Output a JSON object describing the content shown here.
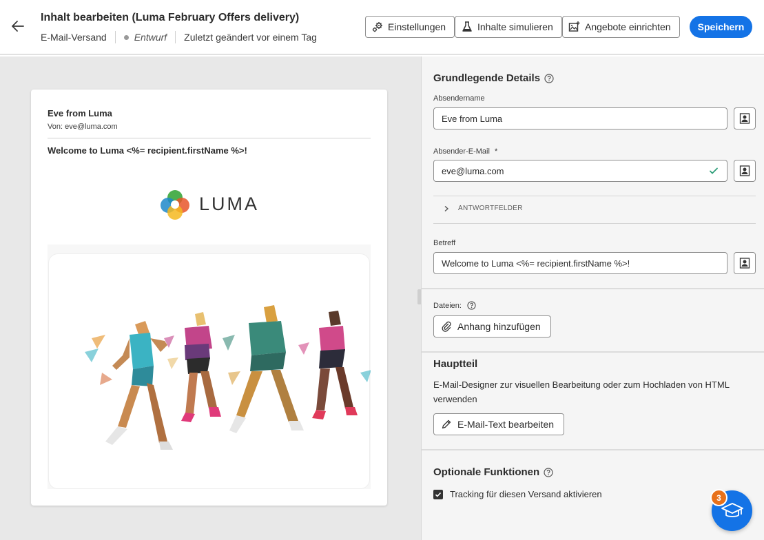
{
  "header": {
    "title": "Inhalt bearbeiten (Luma February Offers delivery)",
    "channel": "E-Mail-Versand",
    "status": "Entwurf",
    "modified": "Zuletzt geändert vor einem Tag",
    "buttons": {
      "settings": "Einstellungen",
      "simulate": "Inhalte simulieren",
      "offers": "Angebote einrichten",
      "save": "Speichern"
    }
  },
  "preview": {
    "sender_name": "Eve from Luma",
    "sender_from": "Von: eve@luma.com",
    "subject": "Welcome to Luma <%= recipient.firstName %>!",
    "logo_text": "LUMA"
  },
  "details": {
    "title": "Grundlegende Details",
    "sender_name_label": "Absendername",
    "sender_name_value": "Eve from Luma",
    "sender_email_label": "Absender-E-Mail",
    "required_mark": "*",
    "sender_email_value": "eve@luma.com",
    "reply_fields": "ANTWORTFELDER",
    "subject_label": "Betreff",
    "subject_value": "Welcome to Luma <%= recipient.firstName %>!"
  },
  "files": {
    "label": "Dateien:",
    "add_button": "Anhang hinzufügen"
  },
  "body_section": {
    "title": "Hauptteil",
    "description": "E-Mail-Designer zur visuellen Bearbeitung oder zum Hochladen von HTML verwenden",
    "edit_button": "E-Mail-Text bearbeiten"
  },
  "optional": {
    "title": "Optionale Funktionen",
    "tracking_label": "Tracking für diesen Versand aktivieren",
    "tracking_checked": true
  },
  "fab": {
    "badge": "3"
  },
  "colors": {
    "accent": "#1473e6",
    "badge": "#e8711a",
    "valid": "#2d9d78"
  }
}
